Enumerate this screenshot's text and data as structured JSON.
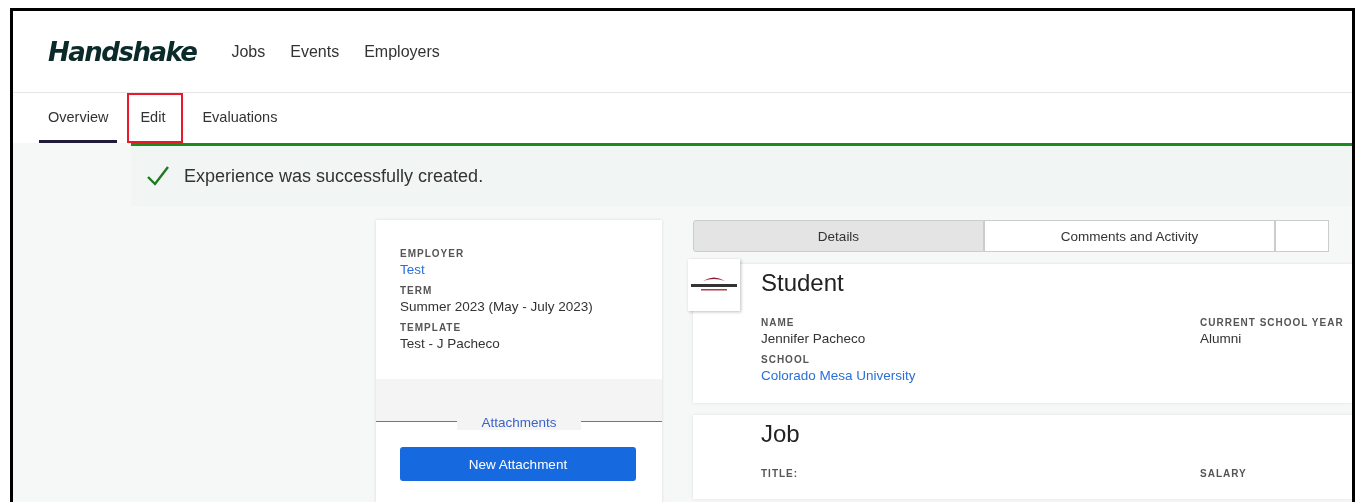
{
  "header": {
    "logo": "Handshake",
    "nav": [
      {
        "label": "Jobs"
      },
      {
        "label": "Events"
      },
      {
        "label": "Employers"
      }
    ]
  },
  "subnav": [
    {
      "label": "Overview",
      "selected": true,
      "annotated": false
    },
    {
      "label": "Edit",
      "selected": false,
      "annotated": true
    },
    {
      "label": "Evaluations",
      "selected": false,
      "annotated": false
    }
  ],
  "alert": {
    "message": "Experience was successfully created."
  },
  "summary": {
    "fields": [
      {
        "label": "EMPLOYER",
        "value": "Test",
        "kind": "link"
      },
      {
        "label": "TERM",
        "value": "Summer 2023 (May - July 2023)",
        "kind": "text"
      },
      {
        "label": "TEMPLATE",
        "value": "Test - J Pacheco",
        "kind": "text"
      }
    ],
    "attachments": {
      "heading": "Attachments",
      "button": "New Attachment"
    }
  },
  "detail_tabs": [
    {
      "label": "Details",
      "selected": true
    },
    {
      "label": "Comments and Activity",
      "selected": false
    }
  ],
  "sections": [
    {
      "title": "Student",
      "logo": true,
      "left_fields": [
        {
          "label": "NAME",
          "value": "Jennifer Pacheco",
          "kind": "text"
        },
        {
          "label": "SCHOOL",
          "value": "Colorado Mesa University",
          "kind": "link"
        }
      ],
      "right_fields": [
        {
          "label": "CURRENT SCHOOL YEAR",
          "value": "Alumni",
          "kind": "text"
        }
      ]
    },
    {
      "title": "Job",
      "logo": false,
      "left_fields": [
        {
          "label": "TITLE:"
        }
      ],
      "right_fields": [
        {
          "label": "SALARY"
        }
      ]
    }
  ]
}
